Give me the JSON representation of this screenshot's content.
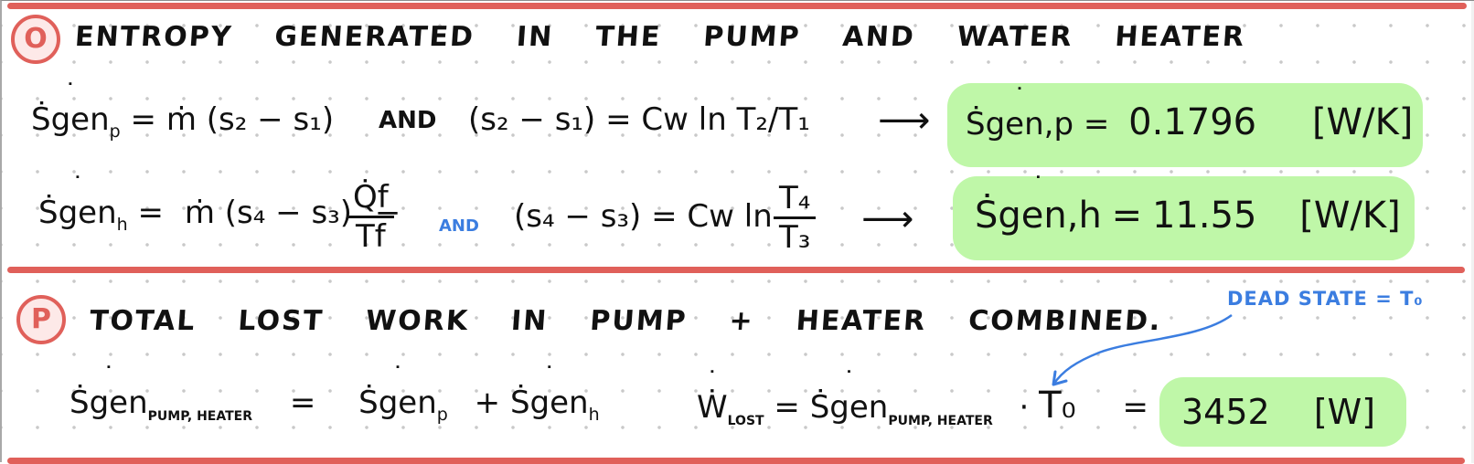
{
  "section_o": {
    "badge": "O",
    "heading_words": [
      "ENTROPY",
      "GENERATED",
      "IN",
      "THE",
      "PUMP",
      "AND",
      "WATER",
      "HEATER"
    ],
    "pump_equation": {
      "lhs": "Ṡgen",
      "lhs_sub": "p",
      "equals": "=",
      "mdot": "ṁ",
      "term": "(s₂ − s₁)",
      "connector": "AND",
      "rel_lhs": "(s₂ − s₁)",
      "rel_rhs": "= Cw ln",
      "ratio": "T₂/T₁",
      "arrow": "⟶",
      "result_lhs": "Ṡgen,p",
      "result_value": "0.1796",
      "result_units": "[W/K]"
    },
    "heater_equation": {
      "lhs": "Ṡgen",
      "lhs_sub": "h",
      "equals": "=",
      "mdot": "ṁ",
      "term": "(s₄ − s₃)",
      "minus": "−",
      "q_num": "Q̇f",
      "q_den": "Tf",
      "connector": "AND",
      "rel_lhs": "(s₄ − s₃)",
      "rel_rhs": "= Cw ln",
      "ratio_num": "T₄",
      "ratio_den": "T₃",
      "arrow": "⟶",
      "result_lhs": "Ṡgen,h",
      "result_value": "11.55",
      "result_units": "[W/K]"
    }
  },
  "section_p": {
    "badge": "P",
    "heading_words": [
      "TOTAL",
      "LOST",
      "WORK",
      "IN",
      "PUMP",
      "+",
      "HEATER",
      "COMBINED."
    ],
    "annotation": "DEAD STATE = T₀",
    "sum_equation": {
      "lhs": "Ṡgen",
      "lhs_sub": "PUMP, HEATER",
      "equals": "=",
      "term1": "Ṡgen",
      "term1_sub": "p",
      "plus": "+",
      "term2": "Ṡgen",
      "term2_sub": "h"
    },
    "lost_work_equation": {
      "lhs": "Ẇ",
      "lhs_sub": "LOST",
      "equals": "=",
      "sgen": "Ṡgen",
      "sgen_sub": "PUMP, HEATER",
      "times": "·",
      "t0": "T₀",
      "equals2": "=",
      "result_value": "3452",
      "result_units": "[W]"
    }
  },
  "colors": {
    "rule_red": "#e0605a",
    "highlight_green": "#bff7a8",
    "annotation_blue": "#3b7de0",
    "ink": "#111111"
  }
}
